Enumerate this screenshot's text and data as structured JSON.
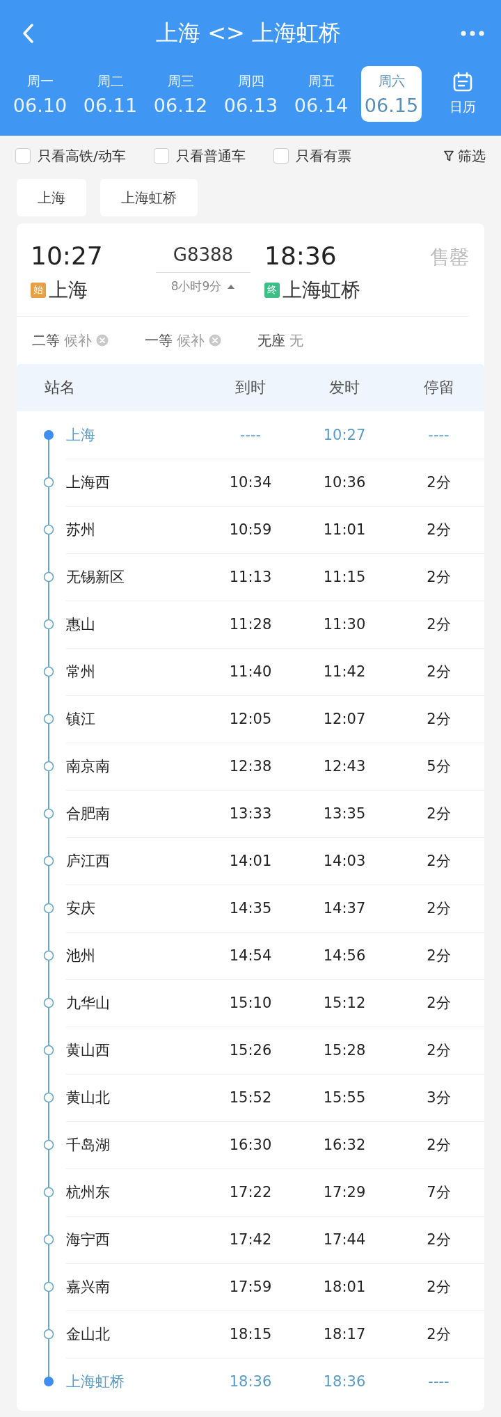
{
  "header": {
    "title": "上海 <> 上海虹桥"
  },
  "dates": [
    {
      "weekday": "周一",
      "date": "06.10",
      "selected": false
    },
    {
      "weekday": "周二",
      "date": "06.11",
      "selected": false
    },
    {
      "weekday": "周三",
      "date": "06.12",
      "selected": false
    },
    {
      "weekday": "周四",
      "date": "06.13",
      "selected": false
    },
    {
      "weekday": "周五",
      "date": "06.14",
      "selected": false
    },
    {
      "weekday": "周六",
      "date": "06.15",
      "selected": true
    }
  ],
  "calendar": {
    "label": "日历"
  },
  "filters": [
    {
      "label": "只看高铁/动车",
      "checked": false
    },
    {
      "label": "只看普通车",
      "checked": false
    },
    {
      "label": "只看有票",
      "checked": false
    }
  ],
  "filter_button": {
    "label": "筛选"
  },
  "station_chips": [
    "上海",
    "上海虹桥"
  ],
  "train": {
    "depart_time": "10:27",
    "number": "G8388",
    "arrive_time": "18:36",
    "status": "售罄",
    "from_badge": "始",
    "from": "上海",
    "duration": "8小时9分",
    "expanded": true,
    "to_badge": "终",
    "to": "上海虹桥"
  },
  "seats": [
    {
      "class": "二等",
      "availability": "候补",
      "kind": "waitlist"
    },
    {
      "class": "一等",
      "availability": "候补",
      "kind": "waitlist"
    },
    {
      "class": "无座",
      "availability": "无",
      "kind": "none"
    }
  ],
  "table": {
    "columns": [
      "站名",
      "到时",
      "发时",
      "停留"
    ],
    "rows": [
      {
        "station": "上海",
        "arrive": "----",
        "depart": "10:27",
        "stay": "----",
        "kind": "terminus"
      },
      {
        "station": "上海西",
        "arrive": "10:34",
        "depart": "10:36",
        "stay": "2分",
        "kind": "stop"
      },
      {
        "station": "苏州",
        "arrive": "10:59",
        "depart": "11:01",
        "stay": "2分",
        "kind": "stop"
      },
      {
        "station": "无锡新区",
        "arrive": "11:13",
        "depart": "11:15",
        "stay": "2分",
        "kind": "stop"
      },
      {
        "station": "惠山",
        "arrive": "11:28",
        "depart": "11:30",
        "stay": "2分",
        "kind": "stop"
      },
      {
        "station": "常州",
        "arrive": "11:40",
        "depart": "11:42",
        "stay": "2分",
        "kind": "stop"
      },
      {
        "station": "镇江",
        "arrive": "12:05",
        "depart": "12:07",
        "stay": "2分",
        "kind": "stop"
      },
      {
        "station": "南京南",
        "arrive": "12:38",
        "depart": "12:43",
        "stay": "5分",
        "kind": "stop"
      },
      {
        "station": "合肥南",
        "arrive": "13:33",
        "depart": "13:35",
        "stay": "2分",
        "kind": "stop"
      },
      {
        "station": "庐江西",
        "arrive": "14:01",
        "depart": "14:03",
        "stay": "2分",
        "kind": "stop"
      },
      {
        "station": "安庆",
        "arrive": "14:35",
        "depart": "14:37",
        "stay": "2分",
        "kind": "stop"
      },
      {
        "station": "池州",
        "arrive": "14:54",
        "depart": "14:56",
        "stay": "2分",
        "kind": "stop"
      },
      {
        "station": "九华山",
        "arrive": "15:10",
        "depart": "15:12",
        "stay": "2分",
        "kind": "stop"
      },
      {
        "station": "黄山西",
        "arrive": "15:26",
        "depart": "15:28",
        "stay": "2分",
        "kind": "stop"
      },
      {
        "station": "黄山北",
        "arrive": "15:52",
        "depart": "15:55",
        "stay": "3分",
        "kind": "stop"
      },
      {
        "station": "千岛湖",
        "arrive": "16:30",
        "depart": "16:32",
        "stay": "2分",
        "kind": "stop"
      },
      {
        "station": "杭州东",
        "arrive": "17:22",
        "depart": "17:29",
        "stay": "7分",
        "kind": "stop"
      },
      {
        "station": "海宁西",
        "arrive": "17:42",
        "depart": "17:44",
        "stay": "2分",
        "kind": "stop"
      },
      {
        "station": "嘉兴南",
        "arrive": "17:59",
        "depart": "18:01",
        "stay": "2分",
        "kind": "stop"
      },
      {
        "station": "金山北",
        "arrive": "18:15",
        "depart": "18:17",
        "stay": "2分",
        "kind": "stop"
      },
      {
        "station": "上海虹桥",
        "arrive": "18:36",
        "depart": "18:36",
        "stay": "----",
        "kind": "terminus"
      }
    ]
  }
}
